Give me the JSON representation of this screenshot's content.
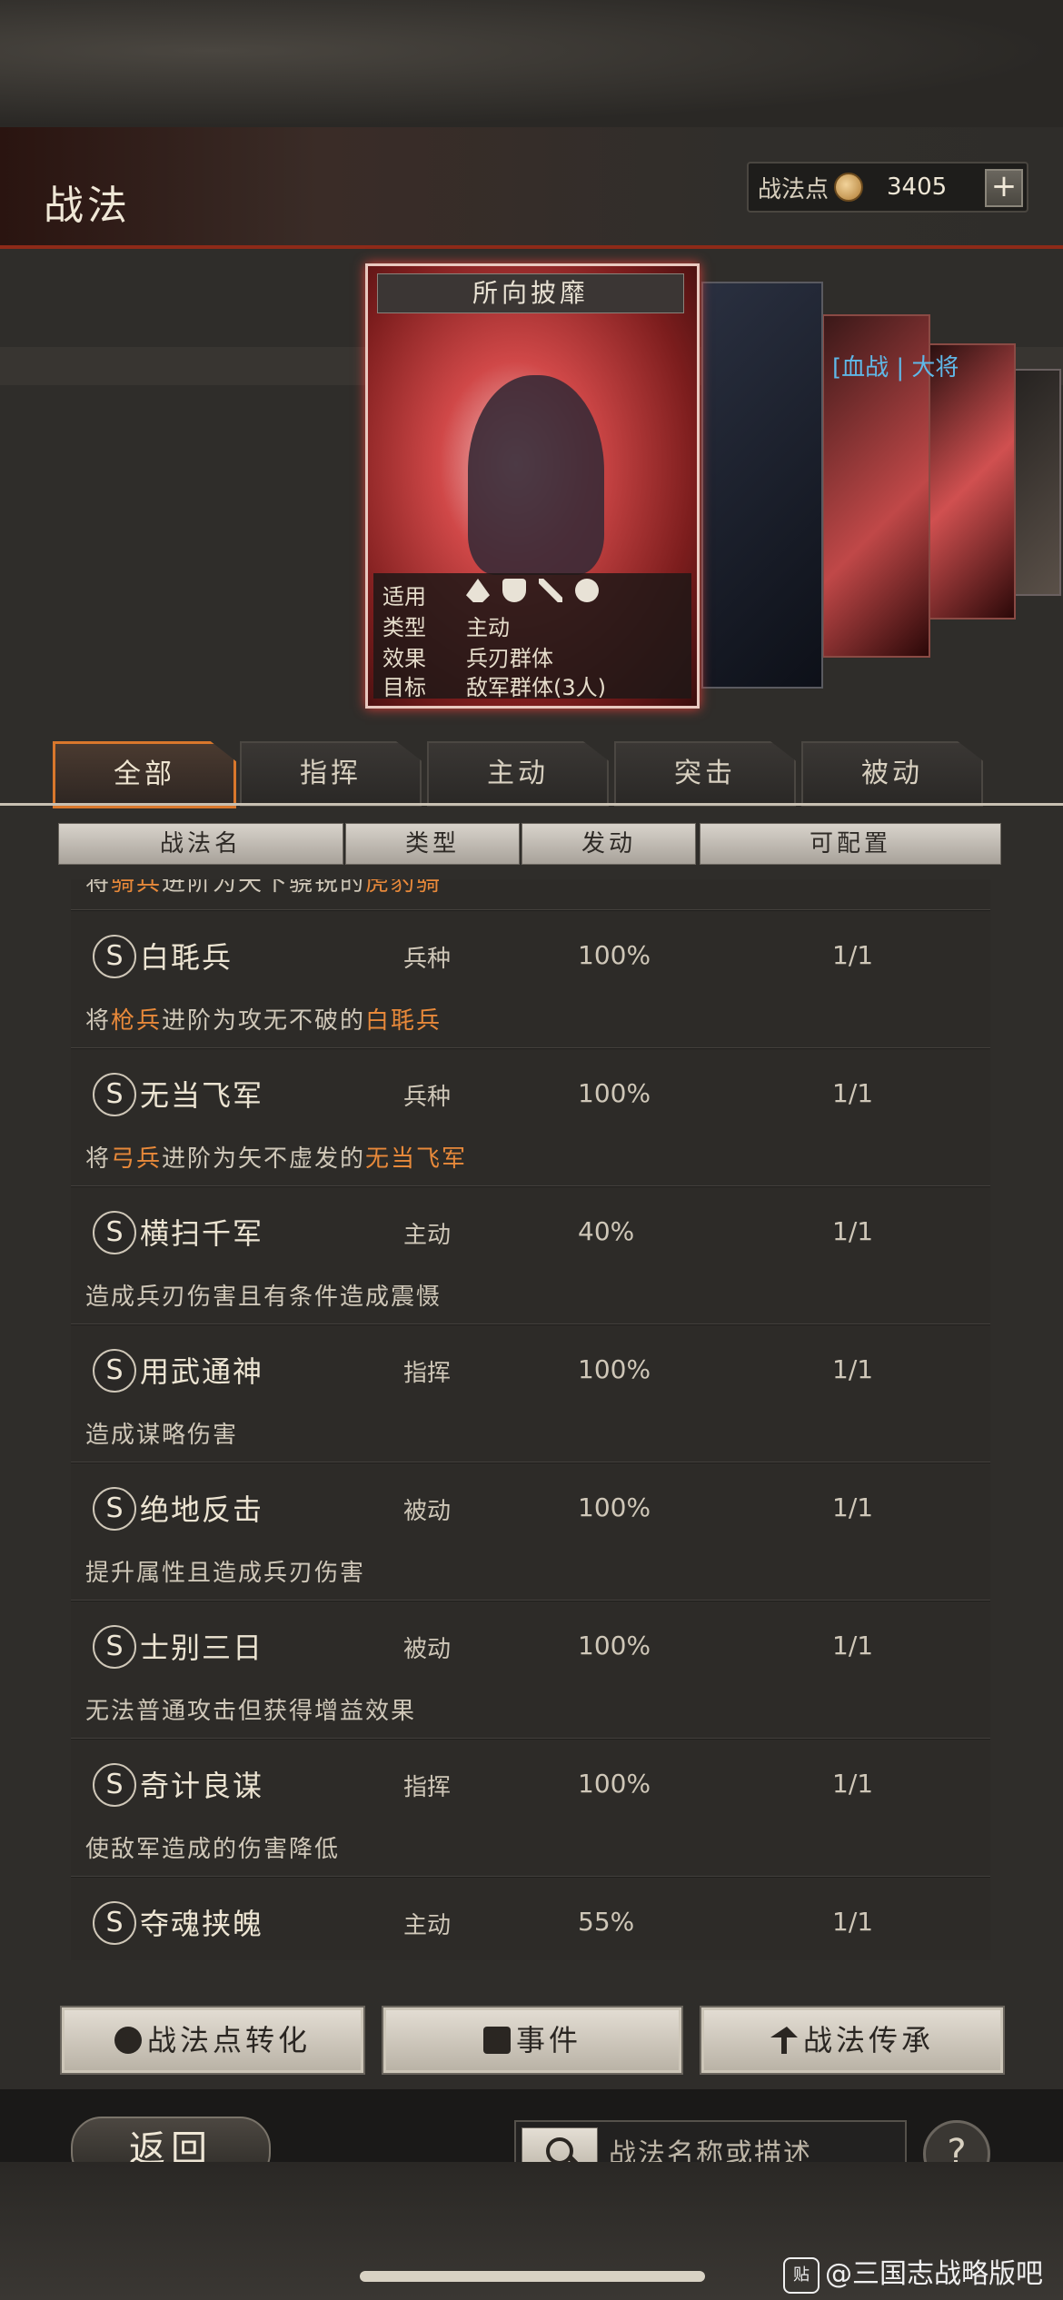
{
  "header": {
    "title": "战法",
    "points_label": "战法点",
    "points_value": "3405",
    "add_label": "+"
  },
  "card": {
    "title": "所向披靡",
    "rows": [
      {
        "label": "适用",
        "value": ""
      },
      {
        "label": "类型",
        "value": "主动"
      },
      {
        "label": "效果",
        "value": "兵刃群体"
      },
      {
        "label": "目标",
        "value": "敌军群体(3人)"
      }
    ],
    "tags": "[血战 | 大将"
  },
  "tabs": [
    "全部",
    "指挥",
    "主动",
    "突击",
    "被动"
  ],
  "active_tab": "全部",
  "columns": [
    "战法名",
    "类型",
    "发动",
    "可配置"
  ],
  "partial_top_desc": [
    "将",
    "骑兵",
    "进阶为天下骁锐的",
    "虎豹骑",
    ""
  ],
  "skills": [
    {
      "badge": "S",
      "name": "白毦兵",
      "type": "兵种",
      "rate": "100%",
      "config": "1/1",
      "desc": [
        "将",
        "枪兵",
        "进阶为攻无不破的",
        "白毦兵",
        ""
      ]
    },
    {
      "badge": "S",
      "name": "无当飞军",
      "type": "兵种",
      "rate": "100%",
      "config": "1/1",
      "desc": [
        "将",
        "弓兵",
        "进阶为矢不虚发的",
        "无当飞军",
        ""
      ]
    },
    {
      "badge": "S",
      "name": "横扫千军",
      "type": "主动",
      "rate": "40%",
      "config": "1/1",
      "desc": [
        "造成兵刃伤害且有条件造成震慑",
        "",
        "",
        "",
        ""
      ]
    },
    {
      "badge": "S",
      "name": "用武通神",
      "type": "指挥",
      "rate": "100%",
      "config": "1/1",
      "desc": [
        "造成谋略伤害",
        "",
        "",
        "",
        ""
      ]
    },
    {
      "badge": "S",
      "name": "绝地反击",
      "type": "被动",
      "rate": "100%",
      "config": "1/1",
      "desc": [
        "提升属性且造成兵刃伤害",
        "",
        "",
        "",
        ""
      ]
    },
    {
      "badge": "S",
      "name": "士别三日",
      "type": "被动",
      "rate": "100%",
      "config": "1/1",
      "desc": [
        "无法普通攻击但获得增益效果",
        "",
        "",
        "",
        ""
      ]
    },
    {
      "badge": "S",
      "name": "奇计良谋",
      "type": "指挥",
      "rate": "100%",
      "config": "1/1",
      "desc": [
        "使敌军造成的伤害降低",
        "",
        "",
        "",
        ""
      ]
    },
    {
      "badge": "S",
      "name": "夺魂挟魄",
      "type": "主动",
      "rate": "55%",
      "config": "1/1",
      "desc": [
        "",
        "",
        "",
        "",
        ""
      ]
    }
  ],
  "actions": {
    "convert": "战法点转化",
    "events": "事件",
    "inherit": "战法传承"
  },
  "footer": {
    "back": "返回",
    "search_placeholder": "战法名称或描述",
    "help": "?"
  },
  "watermark": {
    "logo": "贴",
    "text": "@三国志战略版吧"
  },
  "colors": {
    "accent_orange": "#d9772c",
    "highlight_text": "#e8893a",
    "tag_blue": "#5fb8e8",
    "header_red": "#8e2a18"
  },
  "icons": {
    "applicable_units": [
      "cavalry-icon",
      "shield-icon",
      "bow-icon",
      "chariot-icon"
    ]
  }
}
